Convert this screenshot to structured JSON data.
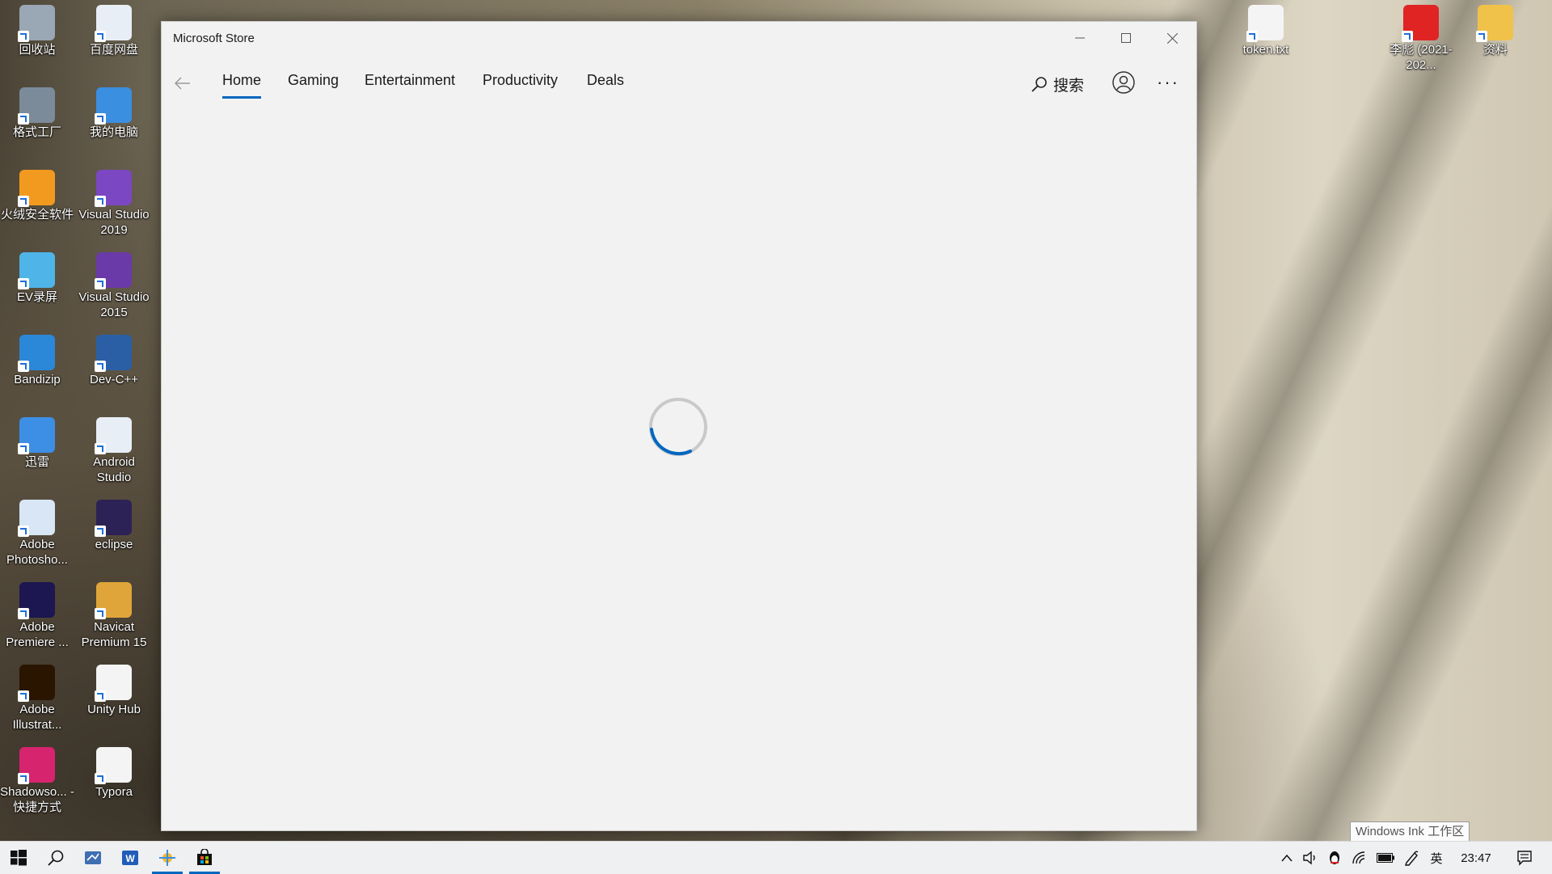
{
  "desktop": {
    "left_column": [
      {
        "label": "回收站",
        "icon": "recycle-bin-icon",
        "color": "#9aa7b4"
      },
      {
        "label": "格式工厂",
        "icon": "format-factory-icon",
        "color": "#7b8b9a"
      },
      {
        "label": "火绒安全软件",
        "icon": "huorong-icon",
        "color": "#f29a1f"
      },
      {
        "label": "EV录屏",
        "icon": "ev-recorder-icon",
        "color": "#4fb5e8"
      },
      {
        "label": "Bandizip",
        "icon": "bandizip-icon",
        "color": "#2b87d8"
      },
      {
        "label": "迅雷",
        "icon": "thunder-icon",
        "color": "#3d8fe6"
      },
      {
        "label": "Adobe Photosho...",
        "icon": "photoshop-icon",
        "color": "#d8e6f5"
      },
      {
        "label": "Adobe Premiere ...",
        "icon": "premiere-icon",
        "color": "#1c1750"
      },
      {
        "label": "Adobe Illustrat...",
        "icon": "illustrator-icon",
        "color": "#2a1500"
      },
      {
        "label": "Shadowso... - 快捷方式",
        "icon": "shadowsocks-icon",
        "color": "#d6246e"
      }
    ],
    "right_column": [
      {
        "label": "百度网盘",
        "icon": "baidu-netdisk-icon",
        "color": "#e8eef6"
      },
      {
        "label": "我的电脑",
        "icon": "my-computer-icon",
        "color": "#3b8fe0"
      },
      {
        "label": "Visual Studio 2019",
        "icon": "visual-studio-2019-icon",
        "color": "#7b47c2"
      },
      {
        "label": "Visual Studio 2015",
        "icon": "visual-studio-2015-icon",
        "color": "#6a3aa8"
      },
      {
        "label": "Dev-C++",
        "icon": "dev-cpp-icon",
        "color": "#2a5fa6"
      },
      {
        "label": "Android Studio",
        "icon": "android-studio-icon",
        "color": "#e8eef6"
      },
      {
        "label": "eclipse",
        "icon": "eclipse-icon",
        "color": "#2c2255"
      },
      {
        "label": "Navicat Premium 15",
        "icon": "navicat-icon",
        "color": "#e0a53a"
      },
      {
        "label": "Unity Hub",
        "icon": "unity-hub-icon",
        "color": "#f4f4f4"
      },
      {
        "label": "Typora",
        "icon": "typora-icon",
        "color": "#f4f4f4"
      }
    ],
    "top_right": [
      {
        "label": "token.txt",
        "icon": "text-file-icon",
        "color": "#f4f4f4"
      },
      {
        "label": "李彪 (2021-202...",
        "icon": "pdf-file-icon",
        "color": "#e02424"
      },
      {
        "label": "资料",
        "icon": "folder-icon",
        "color": "#f0c24a"
      }
    ]
  },
  "window": {
    "title": "Microsoft Store",
    "controls": {
      "minimize": "minimize-icon",
      "maximize": "maximize-icon",
      "close": "close-icon"
    },
    "nav": {
      "back_icon": "back-arrow-icon",
      "tabs": [
        {
          "label": "Home",
          "active": true
        },
        {
          "label": "Gaming",
          "active": false
        },
        {
          "label": "Entertainment",
          "active": false
        },
        {
          "label": "Productivity",
          "active": false
        },
        {
          "label": "Deals",
          "active": false
        }
      ],
      "search_label": "搜索",
      "more_label": "···"
    },
    "loading_spinner": true,
    "accent_color": "#0067c0"
  },
  "ink_tooltip": "Windows Ink 工作区",
  "taskbar": {
    "pinned": [
      {
        "name": "start-button",
        "icon": "windows-logo-icon"
      },
      {
        "name": "search-button",
        "icon": "search-icon"
      },
      {
        "name": "app-1",
        "icon": "app-icon"
      },
      {
        "name": "word",
        "icon": "word-icon"
      },
      {
        "name": "app-3",
        "icon": "app-icon",
        "running": true
      },
      {
        "name": "microsoft-store",
        "icon": "store-icon",
        "running": true
      }
    ],
    "tray": {
      "ime": "英",
      "time": "23:47"
    }
  }
}
